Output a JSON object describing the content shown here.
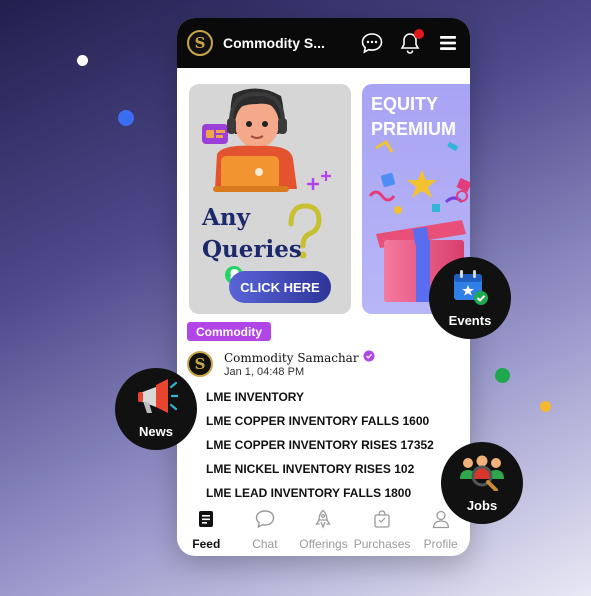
{
  "app": {
    "title": "Commodity S...",
    "logo_letter": "S"
  },
  "top_icons": [
    "chat-bubble-icon",
    "bell-icon",
    "menu-icon"
  ],
  "banners": {
    "queries": {
      "line1": "Any",
      "line2": "Queries",
      "button_label": "CLICK HERE"
    },
    "equity": {
      "line1": "EQUITY",
      "line2": "PREMIUM"
    }
  },
  "post": {
    "tag": "Commodity",
    "author": "Commodity Samachar",
    "date": "Jan 1, 04:48 PM",
    "lines": [
      "LME INVENTORY",
      "LME COPPER INVENTORY FALLS 1600",
      "LME COPPER INVENTORY RISES 17352",
      "LME NICKEL INVENTORY RISES 102",
      "LME LEAD INVENTORY FALLS 1800"
    ]
  },
  "nav": {
    "feed": "Feed",
    "chat": "Chat",
    "offerings": "Offerings",
    "purchases": "Purchases",
    "profile": "Profile"
  },
  "floating": {
    "events": "Events",
    "news": "News",
    "jobs": "Jobs"
  },
  "colors": {
    "accent_purple": "#b245e6",
    "notification": "#e0191f",
    "gold": "#c9a64a",
    "dot_blue": "#3b6df0",
    "dot_green": "#1fa84d",
    "dot_yellow": "#f5b82e"
  }
}
